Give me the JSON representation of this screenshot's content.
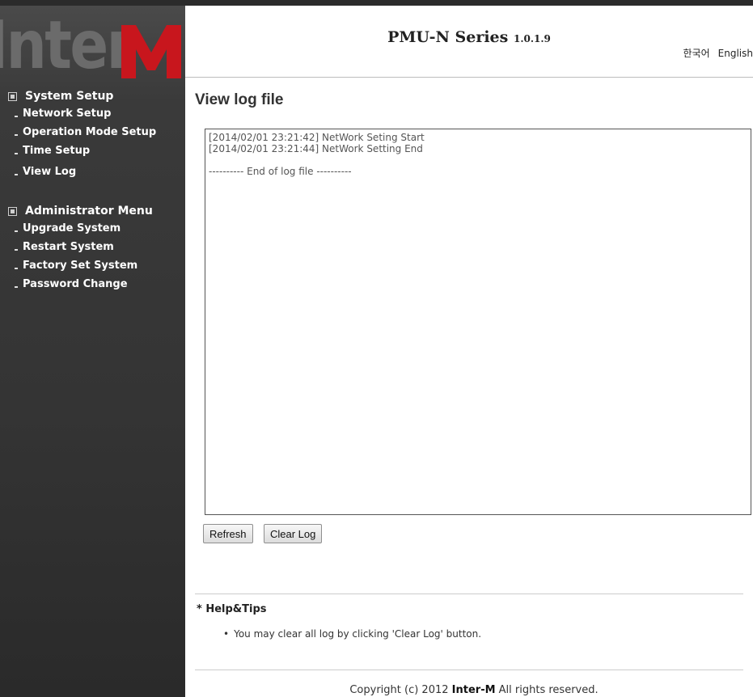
{
  "brand": {
    "logo_text": "InterM",
    "product_name": "PMU-N Series",
    "version": "1.0.1.9"
  },
  "languages": [
    "한국어",
    "English"
  ],
  "sidebar": {
    "sections": [
      {
        "title": "System Setup",
        "items": [
          "Network Setup",
          "Operation Mode Setup",
          "Time Setup",
          "View Log"
        ]
      },
      {
        "title": "Administrator Menu",
        "items": [
          "Upgrade System",
          "Restart System",
          "Factory Set System",
          "Password Change"
        ]
      }
    ]
  },
  "main": {
    "title": "View log file",
    "log_text": "[2014/02/01 23:21:42] NetWork Seting Start\n[2014/02/01 23:21:44] NetWork Setting End\n\n---------- End of log file ----------",
    "buttons": {
      "refresh": "Refresh",
      "clear": "Clear Log"
    }
  },
  "help": {
    "title": "* Help&Tips",
    "tip": "You may clear all log by clicking 'Clear Log' button."
  },
  "footer": {
    "prefix": "Copyright (c) 2012 ",
    "company": "Inter-M",
    "suffix": " All rights reserved."
  },
  "colors": {
    "sidebar_bg": "#3a3a3a",
    "logo_red": "#c8161d",
    "logo_gray": "#6b6b6b"
  }
}
